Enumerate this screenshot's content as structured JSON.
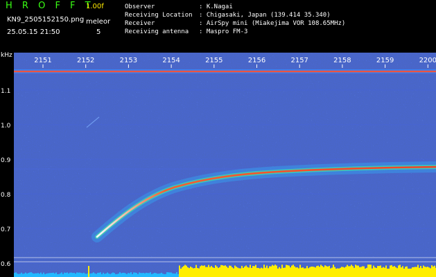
{
  "header": {
    "brand": "H R O F F T",
    "version": "1.00f",
    "filename": "KN9_2505152150.png",
    "mode": "meleor",
    "datetime": "25.05.15 21:50",
    "count": "5",
    "meta": [
      {
        "label": "Observer",
        "value": ": K.Nagai"
      },
      {
        "label": "Receiving Location",
        "value": ": Chigasaki, Japan (139.414 35.340)"
      },
      {
        "label": "Receiver",
        "value": ": AirSpy mini (Miakejima VOR 108.65MHz)"
      },
      {
        "label": "Receiving antenna",
        "value": ": Maspro FM-3"
      }
    ]
  },
  "axis": {
    "unit": "kHz",
    "time_labels": [
      "2151",
      "2152",
      "2153",
      "2154",
      "2155",
      "2156",
      "2157",
      "2158",
      "2159",
      "2200"
    ],
    "freq_labels": [
      "1.1",
      "1.0",
      "0.9",
      "0.8",
      "0.7",
      "0.6"
    ]
  },
  "colors": {
    "background": "#000000",
    "noise": "#1a2fb0",
    "carrier": "#ff5030",
    "meteor_core": "#ff3a1a",
    "meteor_halo": "#30c8ff",
    "level_yellow": "#ffee00",
    "level_cyan": "#22b8ff",
    "label_green": "#39ff14"
  }
}
